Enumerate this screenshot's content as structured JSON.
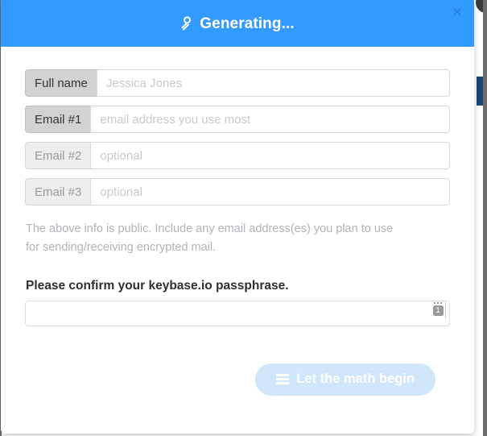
{
  "window": {
    "background_color": "#ffffff",
    "gutter_color": "#6e6e6e"
  },
  "modal": {
    "header": {
      "title": "Generating...",
      "icon": "key-icon",
      "background_color": "#339aff",
      "title_color": "#ffffff",
      "close_label": "×"
    },
    "fields": [
      {
        "label": "Full name",
        "placeholder": "Jessica Jones",
        "value": "",
        "emphasis": "strong",
        "name": "full-name"
      },
      {
        "label": "Email #1",
        "placeholder": "email address you use most",
        "value": "",
        "emphasis": "strong",
        "name": "email-1"
      },
      {
        "label": "Email #2",
        "placeholder": "optional",
        "value": "",
        "emphasis": "muted",
        "name": "email-2"
      },
      {
        "label": "Email #3",
        "placeholder": "optional",
        "value": "",
        "emphasis": "muted",
        "name": "email-3"
      }
    ],
    "help_text": "The above info is public. Include any email address(es) you plan to use for sending/receiving encrypted mail.",
    "passphrase": {
      "label": "Please confirm your keybase.io passphrase.",
      "placeholder": "",
      "value": "",
      "password_manager_badge": "1"
    },
    "submit": {
      "label": "Let the math begin",
      "icon": "tasks-icon",
      "disabled": true,
      "background_color": "#cfe6fb",
      "text_color": "#ffffff"
    }
  }
}
